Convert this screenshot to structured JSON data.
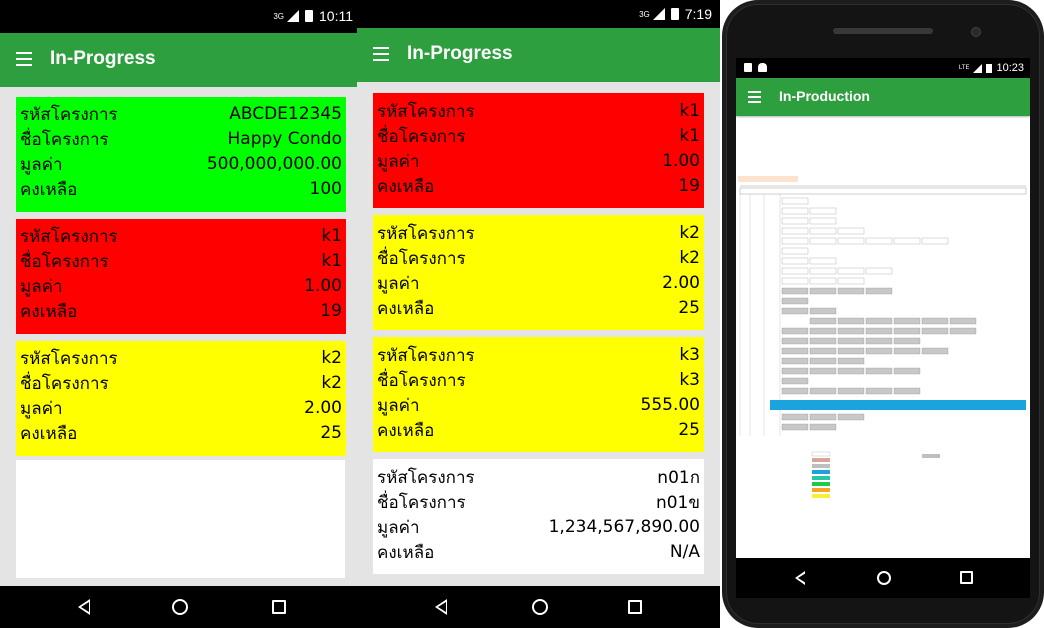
{
  "screen1": {
    "status": {
      "network": "3G",
      "time": "10:11"
    },
    "title": "In-Progress",
    "cards": [
      {
        "color": "green",
        "rows": [
          {
            "label": "รหัสโครงการ",
            "value": "ABCDE12345"
          },
          {
            "label": "ชื่อโครงการ",
            "value": "Happy Condo"
          },
          {
            "label": "มูลค่า",
            "value": "500,000,000.00"
          },
          {
            "label": "คงเหลือ",
            "value": "100"
          }
        ]
      },
      {
        "color": "red",
        "rows": [
          {
            "label": "รหัสโครงการ",
            "value": "k1"
          },
          {
            "label": "ชื่อโครงการ",
            "value": "k1"
          },
          {
            "label": "มูลค่า",
            "value": "1.00"
          },
          {
            "label": "คงเหลือ",
            "value": "19"
          }
        ]
      },
      {
        "color": "yellow",
        "rows": [
          {
            "label": "รหัสโครงการ",
            "value": "k2"
          },
          {
            "label": "ชื่อโครงการ",
            "value": "k2"
          },
          {
            "label": "มูลค่า",
            "value": "2.00"
          },
          {
            "label": "คงเหลือ",
            "value": "25"
          }
        ]
      }
    ]
  },
  "screen2": {
    "status": {
      "network": "3G",
      "time": "7:19"
    },
    "title": "In-Progress",
    "cards": [
      {
        "color": "red",
        "rows": [
          {
            "label": "รหัสโครงการ",
            "value": "k1"
          },
          {
            "label": "ชื่อโครงการ",
            "value": "k1"
          },
          {
            "label": "มูลค่า",
            "value": "1.00"
          },
          {
            "label": "คงเหลือ",
            "value": "19"
          }
        ]
      },
      {
        "color": "yellow",
        "rows": [
          {
            "label": "รหัสโครงการ",
            "value": "k2"
          },
          {
            "label": "ชื่อโครงการ",
            "value": "k2"
          },
          {
            "label": "มูลค่า",
            "value": "2.00"
          },
          {
            "label": "คงเหลือ",
            "value": "25"
          }
        ]
      },
      {
        "color": "yellow",
        "rows": [
          {
            "label": "รหัสโครงการ",
            "value": "k3"
          },
          {
            "label": "ชื่อโครงการ",
            "value": "k3"
          },
          {
            "label": "มูลค่า",
            "value": "555.00"
          },
          {
            "label": "คงเหลือ",
            "value": "25"
          }
        ]
      },
      {
        "color": "white",
        "rows": [
          {
            "label": "รหัสโครงการ",
            "value": "n01ก"
          },
          {
            "label": "ชื่อโครงการ",
            "value": "n01ข"
          },
          {
            "label": "มูลค่า",
            "value": "1,234,567,890.00"
          },
          {
            "label": "คงเหลือ",
            "value": "N/A"
          }
        ]
      }
    ]
  },
  "screen3": {
    "status": {
      "network": "LTE",
      "time": "10:23"
    },
    "title": "In-Production"
  },
  "colors": {
    "appbar": "#2e9f3f",
    "green": "#00ff00",
    "red": "#ff0000",
    "yellow": "#ffff00",
    "white": "#ffffff"
  },
  "icons": [
    "menu-icon",
    "back-icon",
    "home-icon",
    "recents-icon",
    "signal-icon",
    "battery-icon"
  ]
}
